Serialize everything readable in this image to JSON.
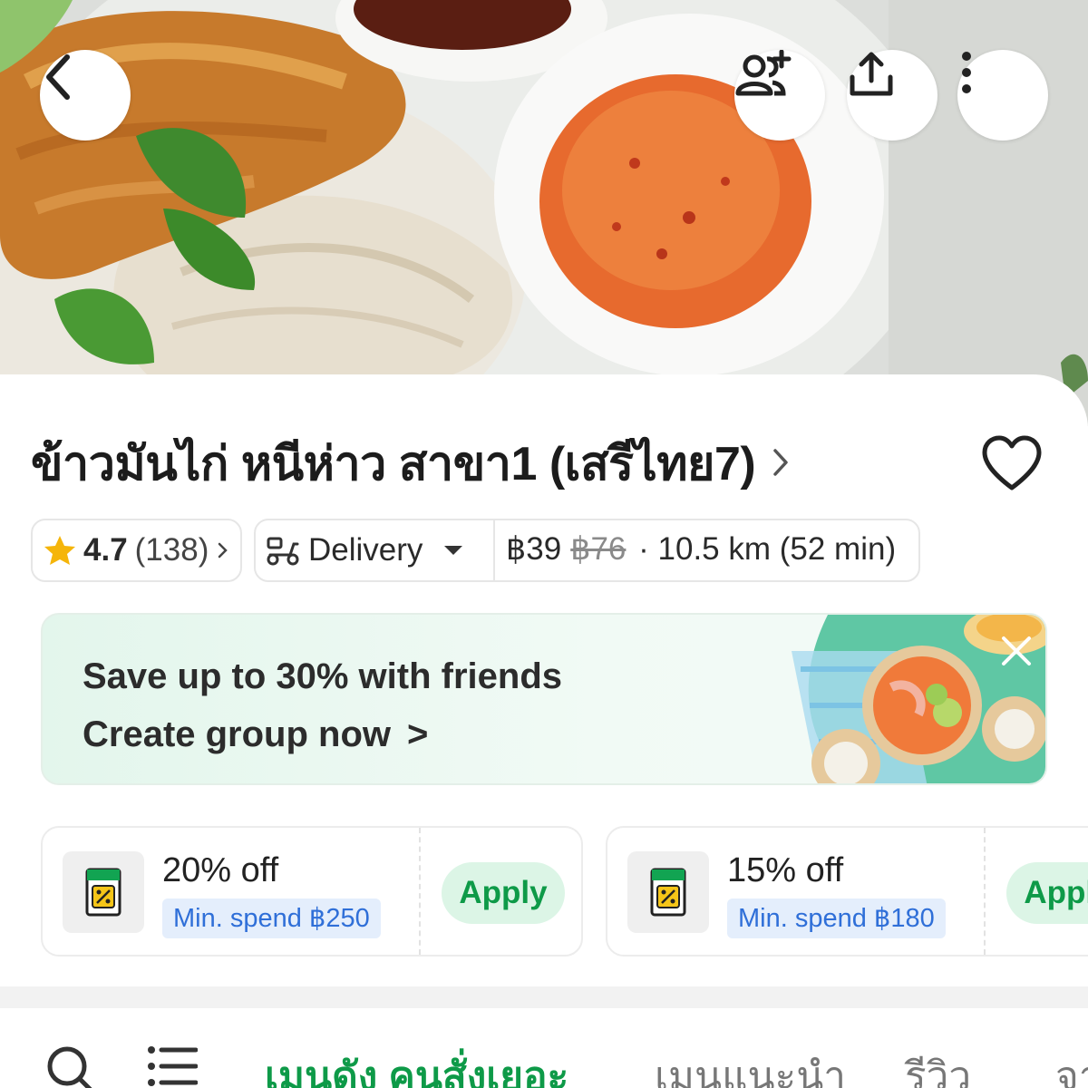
{
  "header": {
    "back_icon": "chevron-left-icon",
    "actions": [
      "group-add-icon",
      "share-upload-icon",
      "more-vertical-icon"
    ]
  },
  "restaurant": {
    "name": "ข้าวมันไก่ หนีห่าว สาขา1 (เสรีไทย7)",
    "rating": "4.7",
    "rating_count": "(138)",
    "delivery_mode": "Delivery",
    "fee": "฿39",
    "fee_original": "฿76",
    "distance_time": "· 10.5 km (52 min)"
  },
  "promo_banner": {
    "line1": "Save up to 30% with friends",
    "line2": "Create group now",
    "arrow": ">"
  },
  "vouchers": [
    {
      "title": "20% off",
      "min_spend": "Min. spend ฿250",
      "action": "Apply"
    },
    {
      "title": "15% off",
      "min_spend": "Min. spend ฿180",
      "action": "Apply"
    }
  ],
  "tabs": [
    "เมนูดัง คนสั่งเยอะ",
    "เมนูแนะนำ",
    "รีวิว",
    "จา"
  ],
  "colors": {
    "accent_green": "#0e9a48",
    "apply_bg": "#dcf5e6",
    "min_spend_text": "#2f6fd8",
    "star": "#f5b50a"
  }
}
